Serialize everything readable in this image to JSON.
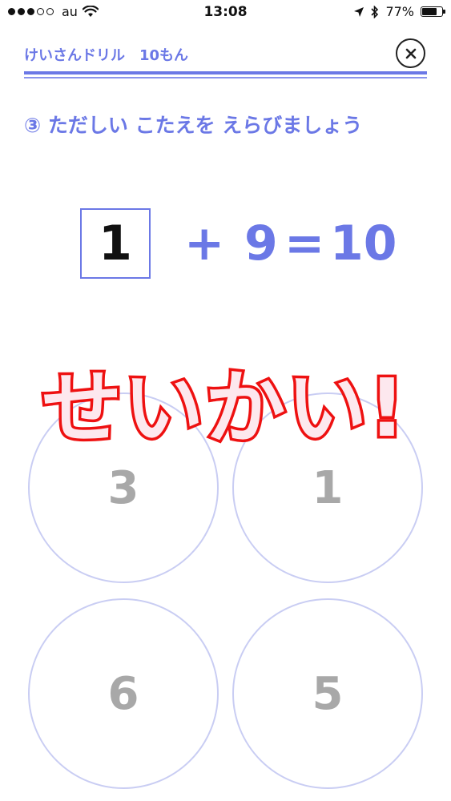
{
  "status_bar": {
    "carrier": "au",
    "time": "13:08",
    "battery_percent": "77%",
    "battery_level": 0.77,
    "signal_dots_on": 3,
    "signal_dots_total": 5
  },
  "header": {
    "title": "けいさんドリル　10もん",
    "close_label": "×"
  },
  "instruction": "③ ただしい こたえを えらびましょう",
  "equation": {
    "answer": "1",
    "operator": "+",
    "operand": "9",
    "equals": "=",
    "result": "10"
  },
  "choices": [
    "3",
    "1",
    "6",
    "5"
  ],
  "feedback": "せいかい!",
  "colors": {
    "accent": "#6b78e6",
    "choice_border": "#c9cdf3",
    "choice_text": "#a8a8a8",
    "feedback_stroke": "#ee1111",
    "feedback_fill": "#fde8ee"
  }
}
